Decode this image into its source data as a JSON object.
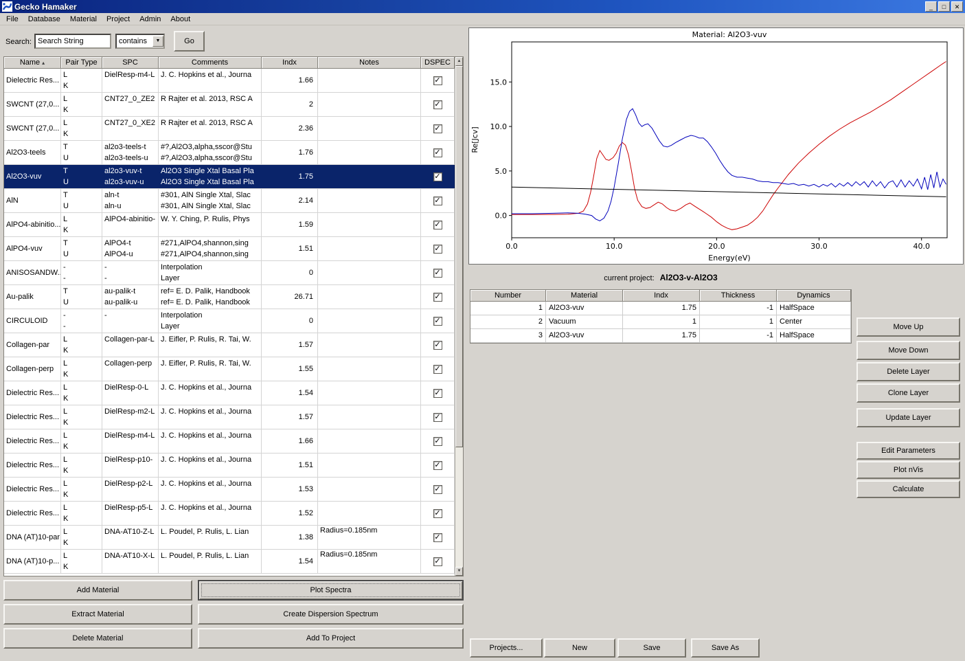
{
  "window": {
    "title": "Gecko Hamaker",
    "controls": {
      "minimize": "_",
      "maximize": "□",
      "close": "✕"
    }
  },
  "menu": {
    "items": [
      "File",
      "Database",
      "Material",
      "Project",
      "Admin",
      "About"
    ]
  },
  "search": {
    "label": "Search:",
    "value": "Search String",
    "mode": "contains",
    "go_label": "Go"
  },
  "icons": {
    "check": "✓",
    "sort": "▴",
    "dropdown_arrow": "▼",
    "scroll_up": "▲",
    "scroll_down": "▼"
  },
  "materials_table": {
    "columns": [
      "Name",
      "Pair Type",
      "SPC",
      "Comments",
      "Indx",
      "Notes",
      "DSPEC"
    ],
    "rows": [
      {
        "name": "Dielectric Res...",
        "pair": [
          "L",
          "K"
        ],
        "spc": [
          "DielResp-m4-L"
        ],
        "comments": [
          "J. C. Hopkins et al., Journa"
        ],
        "indx": "1.66",
        "notes": "",
        "dspec": true,
        "selected": false
      },
      {
        "name": "SWCNT (27,0...",
        "pair": [
          "L",
          "K"
        ],
        "spc": [
          "CNT27_0_ZE2"
        ],
        "comments": [
          "R Rajter et al. 2013, RSC A"
        ],
        "indx": "2",
        "notes": "",
        "dspec": true,
        "selected": false
      },
      {
        "name": "SWCNT (27,0...",
        "pair": [
          "L",
          "K"
        ],
        "spc": [
          "CNT27_0_XE2"
        ],
        "comments": [
          "R Rajter et al. 2013, RSC A"
        ],
        "indx": "2.36",
        "notes": "",
        "dspec": true,
        "selected": false
      },
      {
        "name": "Al2O3-teels",
        "pair": [
          "T",
          "U"
        ],
        "spc": [
          "al2o3-teels-t",
          "al2o3-teels-u"
        ],
        "comments": [
          "#?,Al2O3,alpha,sscor@Stu",
          "#?,Al2O3,alpha,sscor@Stu"
        ],
        "indx": "1.76",
        "notes": "",
        "dspec": true,
        "selected": false
      },
      {
        "name": "Al2O3-vuv",
        "pair": [
          "T",
          "U"
        ],
        "spc": [
          "al2o3-vuv-t",
          "al2o3-vuv-u"
        ],
        "comments": [
          "Al2O3 Single Xtal Basal Pla",
          "Al2O3 Single Xtal Basal Pla"
        ],
        "indx": "1.75",
        "notes": "",
        "dspec": true,
        "selected": true
      },
      {
        "name": "AlN",
        "pair": [
          "T",
          "U"
        ],
        "spc": [
          "aln-t",
          "aln-u"
        ],
        "comments": [
          "#301, AlN Single Xtal, Slac",
          "#301, AlN Single Xtal, Slac"
        ],
        "indx": "2.14",
        "notes": "",
        "dspec": true,
        "selected": false
      },
      {
        "name": "AlPO4-abinitio...",
        "pair": [
          "L",
          "K"
        ],
        "spc": [
          "AlPO4-abinitio-"
        ],
        "comments": [
          "W. Y. Ching, P. Rulis, Phys"
        ],
        "indx": "1.59",
        "notes": "",
        "dspec": true,
        "selected": false
      },
      {
        "name": "AlPO4-vuv",
        "pair": [
          "T",
          "U"
        ],
        "spc": [
          "AlPO4-t",
          "AlPO4-u"
        ],
        "comments": [
          "#271,AlPO4,shannon,sing",
          "#271,AlPO4,shannon,sing"
        ],
        "indx": "1.51",
        "notes": "",
        "dspec": true,
        "selected": false
      },
      {
        "name": "ANISOSANDW...",
        "pair": [
          "-",
          "-"
        ],
        "spc": [
          "-",
          "-"
        ],
        "comments": [
          "Interpolation",
          "Layer"
        ],
        "indx": "0",
        "notes": "",
        "dspec": true,
        "selected": false
      },
      {
        "name": "Au-palik",
        "pair": [
          "T",
          "U"
        ],
        "spc": [
          "au-palik-t",
          "au-palik-u"
        ],
        "comments": [
          "ref= E. D. Palik, Handbook",
          "ref= E. D. Palik, Handbook"
        ],
        "indx": "26.71",
        "notes": "",
        "dspec": true,
        "selected": false
      },
      {
        "name": "CIRCULOID",
        "pair": [
          "-",
          "-"
        ],
        "spc": [
          "-"
        ],
        "comments": [
          "Interpolation",
          "Layer"
        ],
        "indx": "0",
        "notes": "",
        "dspec": true,
        "selected": false
      },
      {
        "name": "Collagen-par",
        "pair": [
          "L",
          "K"
        ],
        "spc": [
          "Collagen-par-L"
        ],
        "comments": [
          "J. Eifler, P. Rulis, R. Tai, W."
        ],
        "indx": "1.57",
        "notes": "",
        "dspec": true,
        "selected": false
      },
      {
        "name": "Collagen-perp",
        "pair": [
          "L",
          "K"
        ],
        "spc": [
          "Collagen-perp"
        ],
        "comments": [
          "J. Eifler, P. Rulis, R. Tai, W."
        ],
        "indx": "1.55",
        "notes": "",
        "dspec": true,
        "selected": false
      },
      {
        "name": "Dielectric Res...",
        "pair": [
          "L",
          "K"
        ],
        "spc": [
          "DielResp-0-L"
        ],
        "comments": [
          "J. C. Hopkins et al., Journa"
        ],
        "indx": "1.54",
        "notes": "",
        "dspec": true,
        "selected": false
      },
      {
        "name": "Dielectric Res...",
        "pair": [
          "L",
          "K"
        ],
        "spc": [
          "DielResp-m2-L"
        ],
        "comments": [
          "J. C. Hopkins et al., Journa"
        ],
        "indx": "1.57",
        "notes": "",
        "dspec": true,
        "selected": false
      },
      {
        "name": "Dielectric Res...",
        "pair": [
          "L",
          "K"
        ],
        "spc": [
          "DielResp-m4-L"
        ],
        "comments": [
          "J. C. Hopkins et al., Journa"
        ],
        "indx": "1.66",
        "notes": "",
        "dspec": true,
        "selected": false
      },
      {
        "name": "Dielectric Res...",
        "pair": [
          "L",
          "K"
        ],
        "spc": [
          "DielResp-p10-"
        ],
        "comments": [
          "J. C. Hopkins et al., Journa"
        ],
        "indx": "1.51",
        "notes": "",
        "dspec": true,
        "selected": false
      },
      {
        "name": "Dielectric Res...",
        "pair": [
          "L",
          "K"
        ],
        "spc": [
          "DielResp-p2-L"
        ],
        "comments": [
          "J. C. Hopkins et al., Journa"
        ],
        "indx": "1.53",
        "notes": "",
        "dspec": true,
        "selected": false
      },
      {
        "name": "Dielectric Res...",
        "pair": [
          "L",
          "K"
        ],
        "spc": [
          "DielResp-p5-L"
        ],
        "comments": [
          "J. C. Hopkins et al., Journa"
        ],
        "indx": "1.52",
        "notes": "",
        "dspec": true,
        "selected": false
      },
      {
        "name": "DNA (AT)10-par",
        "pair": [
          "L",
          "K"
        ],
        "spc": [
          "DNA-AT10-Z-L"
        ],
        "comments": [
          "L. Poudel, P. Rulis, L. Lian"
        ],
        "indx": "1.38",
        "notes": "Radius=0.185nm",
        "dspec": true,
        "selected": false
      },
      {
        "name": "DNA (AT)10-p...",
        "pair": [
          "L",
          "K"
        ],
        "spc": [
          "DNA-AT10-X-L"
        ],
        "comments": [
          "L. Poudel, P. Rulis, L. Lian"
        ],
        "indx": "1.54",
        "notes": "Radius=0.185nm",
        "dspec": true,
        "selected": false
      }
    ]
  },
  "buttons": {
    "material": [
      "Add Material",
      "Extract Material",
      "Delete Material"
    ],
    "spectra": [
      "Plot Spectra",
      "Create Dispersion Spectrum",
      "Add To Project"
    ],
    "layer": [
      "Move Up",
      "Move Down",
      "Delete Layer",
      "Clone Layer",
      "Update Layer"
    ],
    "compute": [
      "Edit Parameters",
      "Plot nVis",
      "Calculate"
    ],
    "project_bar": [
      "Projects...",
      "New",
      "Save",
      "Save As"
    ]
  },
  "project": {
    "header_label": "current project:",
    "name": "Al2O3-v-Al2O3",
    "columns": [
      "Number",
      "Material",
      "Indx",
      "Thickness",
      "Dynamics"
    ],
    "layers": [
      {
        "number": "1",
        "material": "Al2O3-vuv",
        "indx": "1.75",
        "thickness": "-1",
        "dynamics": "HalfSpace"
      },
      {
        "number": "2",
        "material": "Vacuum",
        "indx": "1",
        "thickness": "1",
        "dynamics": "Center"
      },
      {
        "number": "3",
        "material": "Al2O3-vuv",
        "indx": "1.75",
        "thickness": "-1",
        "dynamics": "HalfSpace"
      }
    ]
  },
  "chart_data": {
    "type": "line",
    "title": "Material: Al2O3-vuv",
    "xlabel": "Energy(eV)",
    "ylabel": "Re[Jcv]",
    "xlim": [
      0,
      42.5
    ],
    "ylim": [
      -2.5,
      19.5
    ],
    "xticks": [
      0,
      10,
      20,
      30,
      40
    ],
    "yticks": [
      0,
      5,
      10,
      15
    ],
    "grid": false,
    "legend": "none",
    "series": [
      {
        "name": "red-curve",
        "color": "#cc0000",
        "points": [
          [
            0,
            0.1
          ],
          [
            2,
            0.1
          ],
          [
            4,
            0.12
          ],
          [
            5.5,
            0.15
          ],
          [
            6.5,
            0.25
          ],
          [
            7,
            0.5
          ],
          [
            7.4,
            1.3
          ],
          [
            7.7,
            2.6
          ],
          [
            8,
            4.4
          ],
          [
            8.3,
            6.4
          ],
          [
            8.6,
            7.3
          ],
          [
            8.9,
            6.8
          ],
          [
            9.2,
            6.3
          ],
          [
            9.5,
            6.2
          ],
          [
            9.9,
            6.5
          ],
          [
            10.2,
            7.0
          ],
          [
            10.5,
            7.8
          ],
          [
            10.8,
            8.2
          ],
          [
            11.1,
            7.9
          ],
          [
            11.4,
            6.8
          ],
          [
            11.7,
            5.0
          ],
          [
            12,
            3.0
          ],
          [
            12.3,
            1.7
          ],
          [
            12.7,
            1.0
          ],
          [
            13.1,
            0.8
          ],
          [
            13.5,
            0.9
          ],
          [
            13.9,
            1.2
          ],
          [
            14.3,
            1.5
          ],
          [
            14.7,
            1.3
          ],
          [
            15.1,
            0.9
          ],
          [
            15.5,
            0.6
          ],
          [
            16,
            0.5
          ],
          [
            16.5,
            0.8
          ],
          [
            17,
            1.2
          ],
          [
            17.4,
            1.4
          ],
          [
            17.8,
            1.1
          ],
          [
            18.2,
            0.8
          ],
          [
            18.6,
            0.5
          ],
          [
            19,
            0.2
          ],
          [
            19.5,
            -0.2
          ],
          [
            20,
            -0.7
          ],
          [
            20.5,
            -1.1
          ],
          [
            21,
            -1.4
          ],
          [
            21.5,
            -1.6
          ],
          [
            22,
            -1.5
          ],
          [
            22.5,
            -1.3
          ],
          [
            23,
            -1.1
          ],
          [
            23.5,
            -0.7
          ],
          [
            24,
            -0.2
          ],
          [
            24.5,
            0.5
          ],
          [
            25,
            1.4
          ],
          [
            25.5,
            2.3
          ],
          [
            26,
            3.1
          ],
          [
            27,
            4.6
          ],
          [
            28,
            5.9
          ],
          [
            29,
            7.0
          ],
          [
            30,
            8.0
          ],
          [
            31,
            8.9
          ],
          [
            32,
            9.7
          ],
          [
            33,
            10.4
          ],
          [
            34,
            11.0
          ],
          [
            35,
            11.6
          ],
          [
            36,
            12.3
          ],
          [
            37,
            13.0
          ],
          [
            38,
            13.8
          ],
          [
            39,
            14.6
          ],
          [
            40,
            15.4
          ],
          [
            41,
            16.2
          ],
          [
            42,
            17.0
          ],
          [
            42.4,
            17.3
          ]
        ]
      },
      {
        "name": "blue-curve",
        "color": "#0000bb",
        "points": [
          [
            0,
            0.2
          ],
          [
            2,
            0.2
          ],
          [
            4,
            0.25
          ],
          [
            5.5,
            0.3
          ],
          [
            6.5,
            0.25
          ],
          [
            7.2,
            0.15
          ],
          [
            7.8,
            0.0
          ],
          [
            8.2,
            -0.4
          ],
          [
            8.6,
            -0.6
          ],
          [
            9,
            -0.3
          ],
          [
            9.4,
            0.5
          ],
          [
            9.7,
            1.6
          ],
          [
            10,
            3.2
          ],
          [
            10.4,
            5.8
          ],
          [
            10.8,
            8.6
          ],
          [
            11.2,
            10.8
          ],
          [
            11.5,
            11.7
          ],
          [
            11.8,
            12.0
          ],
          [
            12.1,
            11.3
          ],
          [
            12.4,
            10.4
          ],
          [
            12.7,
            10.0
          ],
          [
            13,
            10.2
          ],
          [
            13.3,
            10.3
          ],
          [
            13.7,
            9.8
          ],
          [
            14,
            9.2
          ],
          [
            14.4,
            8.4
          ],
          [
            14.8,
            7.8
          ],
          [
            15.2,
            7.7
          ],
          [
            15.6,
            7.9
          ],
          [
            16,
            8.2
          ],
          [
            16.5,
            8.5
          ],
          [
            17,
            8.8
          ],
          [
            17.5,
            9.0
          ],
          [
            17.9,
            8.9
          ],
          [
            18.3,
            8.7
          ],
          [
            18.7,
            8.7
          ],
          [
            19.1,
            8.3
          ],
          [
            19.5,
            7.7
          ],
          [
            19.9,
            7.0
          ],
          [
            20.3,
            6.2
          ],
          [
            20.7,
            5.5
          ],
          [
            21.1,
            4.9
          ],
          [
            21.5,
            4.5
          ],
          [
            22,
            4.3
          ],
          [
            22.5,
            4.3
          ],
          [
            23,
            4.2
          ],
          [
            23.5,
            4.1
          ],
          [
            24,
            3.9
          ],
          [
            24.5,
            3.8
          ],
          [
            25,
            3.8
          ],
          [
            25.5,
            3.7
          ],
          [
            26,
            3.7
          ],
          [
            26.5,
            3.6
          ],
          [
            27,
            3.5
          ],
          [
            27.5,
            3.6
          ],
          [
            28,
            3.4
          ],
          [
            28.5,
            3.5
          ],
          [
            29,
            3.3
          ],
          [
            29.5,
            3.5
          ],
          [
            30,
            3.2
          ],
          [
            30.4,
            3.5
          ],
          [
            30.8,
            3.3
          ],
          [
            31.2,
            3.6
          ],
          [
            31.6,
            3.2
          ],
          [
            32,
            3.6
          ],
          [
            32.4,
            3.3
          ],
          [
            32.8,
            3.7
          ],
          [
            33.2,
            3.3
          ],
          [
            33.6,
            3.8
          ],
          [
            34,
            3.4
          ],
          [
            34.4,
            3.8
          ],
          [
            34.8,
            3.2
          ],
          [
            35.2,
            3.9
          ],
          [
            35.6,
            3.3
          ],
          [
            36,
            3.8
          ],
          [
            36.4,
            3.1
          ],
          [
            36.8,
            3.7
          ],
          [
            37.2,
            3.9
          ],
          [
            37.6,
            3.2
          ],
          [
            38,
            4.0
          ],
          [
            38.4,
            3.2
          ],
          [
            38.8,
            3.9
          ],
          [
            39.2,
            3.3
          ],
          [
            39.6,
            4.1
          ],
          [
            40,
            3.0
          ],
          [
            40.3,
            4.3
          ],
          [
            40.6,
            2.9
          ],
          [
            40.9,
            4.6
          ],
          [
            41.2,
            3.1
          ],
          [
            41.5,
            4.9
          ],
          [
            41.8,
            3.2
          ],
          [
            42.1,
            4.1
          ],
          [
            42.4,
            3.5
          ]
        ]
      },
      {
        "name": "black-baseline",
        "color": "#000000",
        "points": [
          [
            0,
            3.2
          ],
          [
            42.4,
            2.1
          ]
        ]
      }
    ]
  }
}
